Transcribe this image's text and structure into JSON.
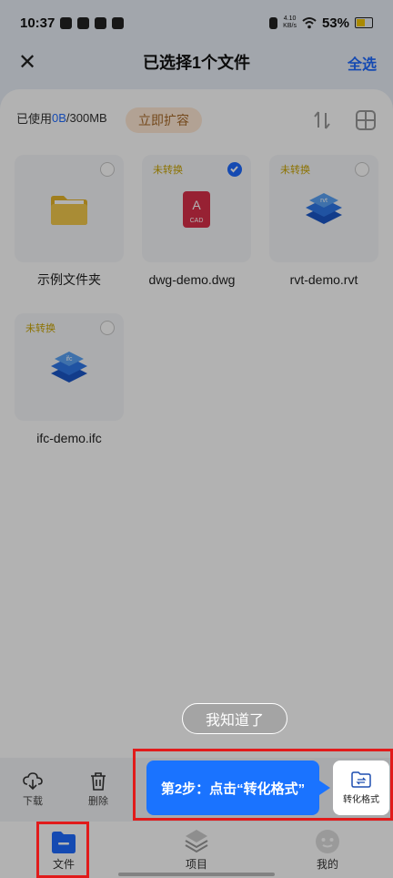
{
  "status_bar": {
    "time": "10:37",
    "net_speed_value": "4.10",
    "net_speed_unit": "KB/s",
    "battery": "53%"
  },
  "header": {
    "title": "已选择1个文件",
    "select_all": "全选"
  },
  "storage": {
    "prefix": "已使用",
    "used": "0B",
    "total": "/300MB",
    "expand_label": "立即扩容"
  },
  "files": [
    {
      "name": "示例文件夹",
      "tag": "",
      "selected": false,
      "icon": "folder-icon"
    },
    {
      "name": "dwg-demo.dwg",
      "tag": "未转换",
      "selected": true,
      "icon": "cad-file-icon"
    },
    {
      "name": "rvt-demo.rvt",
      "tag": "未转换",
      "selected": false,
      "icon": "rvt-layers-icon"
    },
    {
      "name": "ifc-demo.ifc",
      "tag": "未转换",
      "selected": false,
      "icon": "ifc-layers-icon"
    }
  ],
  "actions": {
    "download": "下载",
    "delete": "删除"
  },
  "guide": {
    "got_it": "我知道了",
    "step_tip": "第2步：点击“转化格式”",
    "convert": "转化格式"
  },
  "nav": {
    "files": "文件",
    "projects": "项目",
    "mine": "我的"
  },
  "colors": {
    "accent": "#1f6bff",
    "highlight": "#e11b1b",
    "tag": "#c9a400"
  }
}
